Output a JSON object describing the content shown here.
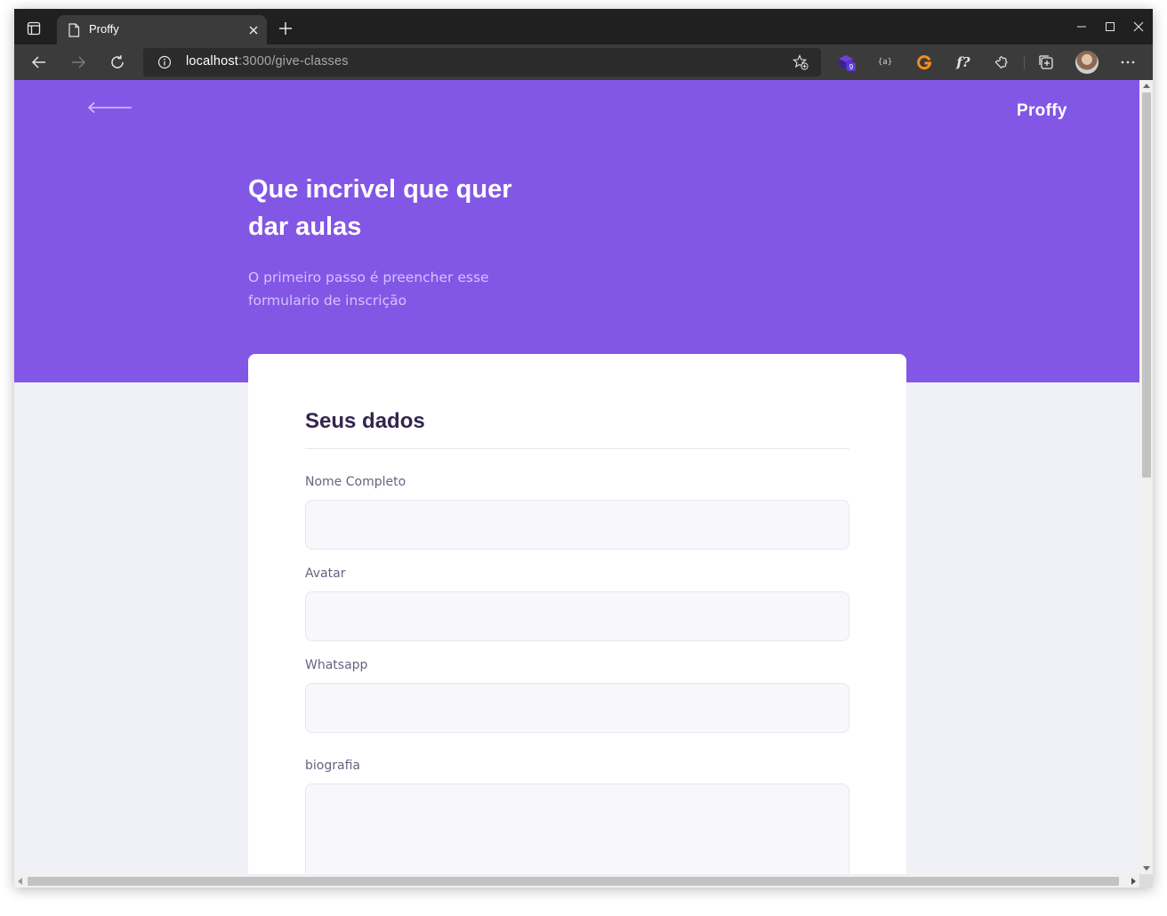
{
  "browser": {
    "tab_title": "Proffy",
    "url_host": "localhost",
    "url_path": ":3000/give-classes",
    "extension_badge": "9",
    "extension_text_icon": "f?",
    "extension_bracket_icon": "{a}"
  },
  "page": {
    "brand": "Proffy",
    "hero_title": "Que incrivel que quer dar aulas",
    "hero_subtitle": "O primeiro passo é preencher esse formulario de inscrição",
    "form": {
      "legend": "Seus dados",
      "fields": [
        {
          "label": "Nome Completo",
          "value": ""
        },
        {
          "label": "Avatar",
          "value": ""
        },
        {
          "label": "Whatsapp",
          "value": ""
        },
        {
          "label": "biografia",
          "value": ""
        }
      ]
    }
  },
  "colors": {
    "primary": "#8257e5",
    "background": "#f0f0f7",
    "title": "#32264d",
    "subtitle": "#d4c2ff",
    "label": "#6a6180",
    "input_bg": "#f8f8fc"
  }
}
